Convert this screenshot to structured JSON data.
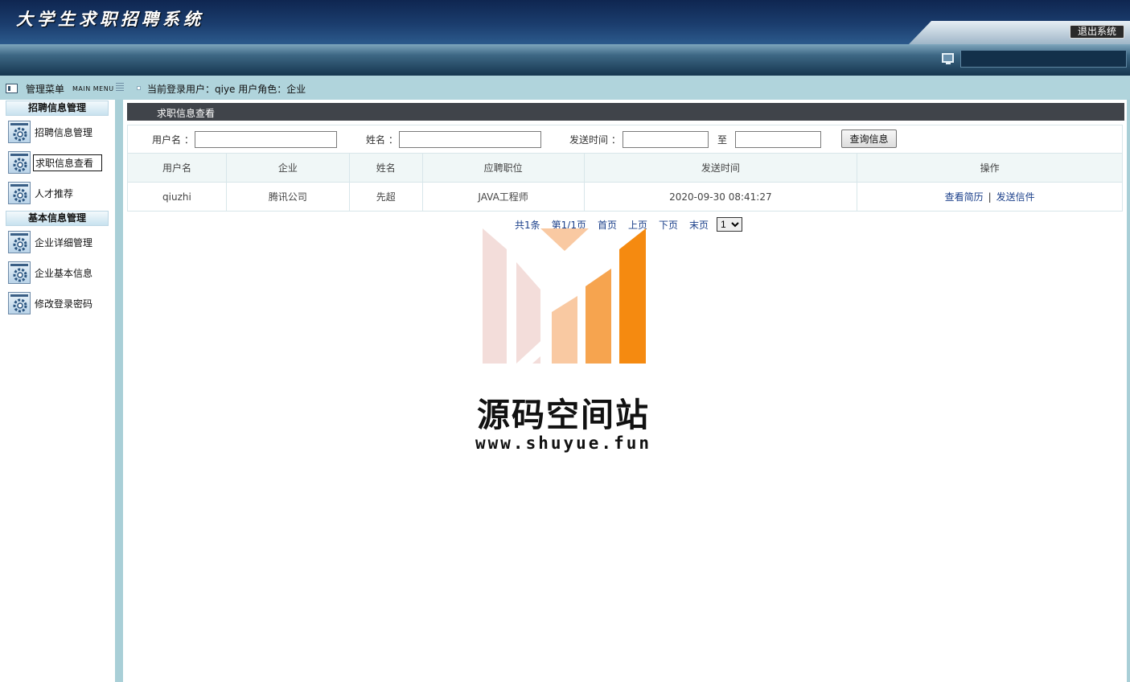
{
  "header": {
    "app_title": "大学生求职招聘系统",
    "logout_label": "退出系统"
  },
  "subbar": {
    "menu_title": "管理菜单",
    "menu_subtitle": "MAIN MENU",
    "login_info": "当前登录用户：qiye  用户角色：企业"
  },
  "sidebar": {
    "groups": [
      {
        "title": "招聘信息管理",
        "items": [
          {
            "label": "招聘信息管理",
            "icon": "gear-icon",
            "active": false
          },
          {
            "label": "求职信息查看",
            "icon": "gear-icon",
            "active": true
          },
          {
            "label": "人才推荐",
            "icon": "gear-icon",
            "active": false
          }
        ]
      },
      {
        "title": "基本信息管理",
        "items": [
          {
            "label": "企业详细管理",
            "icon": "gear-icon",
            "active": false
          },
          {
            "label": "企业基本信息",
            "icon": "gear-icon",
            "active": false
          },
          {
            "label": "修改登录密码",
            "icon": "gear-icon",
            "active": false
          }
        ]
      }
    ]
  },
  "panel": {
    "title": "求职信息查看"
  },
  "search": {
    "username_label": "用户名 ：",
    "username_value": "",
    "name_label": "姓名 ：",
    "name_value": "",
    "send_time_label": "发送时间 ：",
    "send_time_from": "",
    "to_label": "至",
    "send_time_to": "",
    "query_button": "查询信息"
  },
  "table": {
    "columns": [
      "用户名",
      "企业",
      "姓名",
      "应聘职位",
      "发送时间",
      "操作"
    ],
    "rows": [
      {
        "username": "qiuzhi",
        "company": "腾讯公司",
        "name": "先超",
        "position": "JAVA工程师",
        "send_time": "2020-09-30 08:41:27",
        "action_view": "查看简历",
        "action_sep": "|",
        "action_send": "发送信件"
      }
    ]
  },
  "pager": {
    "total": "共1条",
    "page_info": "第1/1页",
    "first": "首页",
    "prev": "上页",
    "next": "下页",
    "last": "末页",
    "selected_page": "1"
  },
  "watermark": {
    "title": "源码空间站",
    "url": "www.shuyue.fun",
    "colors": [
      "#f2d9d6",
      "#f9c9a2",
      "#f6a44f",
      "#f58a10"
    ]
  }
}
